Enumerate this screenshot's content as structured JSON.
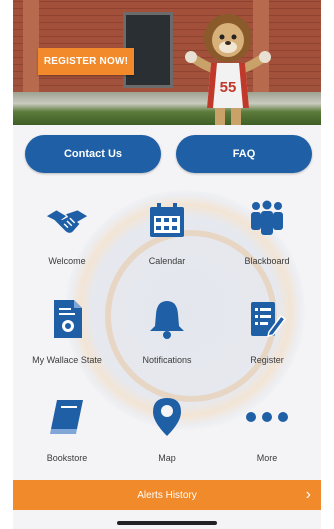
{
  "hero": {
    "register_label": "REGISTER NOW!",
    "jersey_number": "55"
  },
  "buttons": {
    "contact_label": "Contact Us",
    "faq_label": "FAQ"
  },
  "tiles": [
    {
      "label": "Welcome",
      "icon": "handshake-icon"
    },
    {
      "label": "Calendar",
      "icon": "calendar-icon"
    },
    {
      "label": "Blackboard",
      "icon": "people-icon"
    },
    {
      "label": "My Wallace State",
      "icon": "document-icon"
    },
    {
      "label": "Notifications",
      "icon": "bell-icon"
    },
    {
      "label": "Register",
      "icon": "edit-list-icon"
    },
    {
      "label": "Bookstore",
      "icon": "book-icon"
    },
    {
      "label": "Map",
      "icon": "map-pin-icon"
    },
    {
      "label": "More",
      "icon": "more-dots-icon"
    }
  ],
  "alerts": {
    "label": "Alerts History"
  },
  "colors": {
    "primary_blue": "#1f5fa6",
    "accent_orange": "#f08a2a"
  }
}
